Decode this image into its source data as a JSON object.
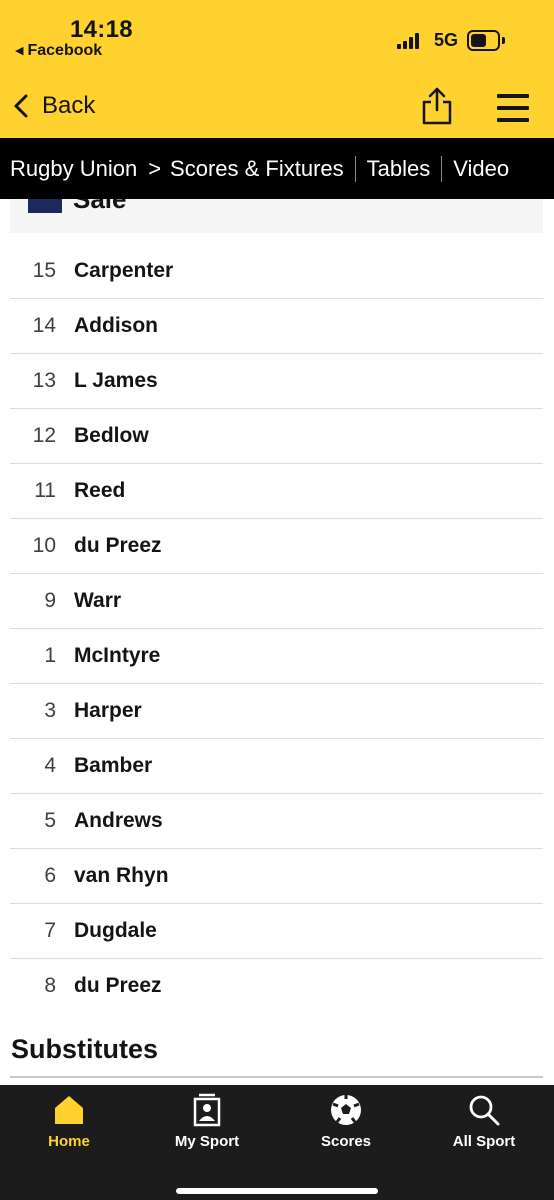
{
  "status": {
    "time": "14:18",
    "source_app": "Facebook",
    "network": "5G"
  },
  "header": {
    "back_label": "Back"
  },
  "nav": {
    "breadcrumb": "Rugby Union",
    "items": [
      "Scores & Fixtures",
      "Tables",
      "Video"
    ]
  },
  "team": {
    "name": "Sale"
  },
  "players": [
    {
      "number": "15",
      "name": "Carpenter"
    },
    {
      "number": "14",
      "name": "Addison"
    },
    {
      "number": "13",
      "name": "L James"
    },
    {
      "number": "12",
      "name": "Bedlow"
    },
    {
      "number": "11",
      "name": "Reed"
    },
    {
      "number": "10",
      "name": "du Preez"
    },
    {
      "number": "9",
      "name": "Warr"
    },
    {
      "number": "1",
      "name": "McIntyre"
    },
    {
      "number": "3",
      "name": "Harper"
    },
    {
      "number": "4",
      "name": "Bamber"
    },
    {
      "number": "5",
      "name": "Andrews"
    },
    {
      "number": "6",
      "name": "van Rhyn"
    },
    {
      "number": "7",
      "name": "Dugdale"
    },
    {
      "number": "8",
      "name": "du Preez"
    }
  ],
  "section": {
    "substitutes": "Substitutes"
  },
  "tabs": [
    {
      "label": "Home",
      "icon": "home-icon",
      "active": true
    },
    {
      "label": "My Sport",
      "icon": "my-sport-icon",
      "active": false
    },
    {
      "label": "Scores",
      "icon": "football-icon",
      "active": false
    },
    {
      "label": "All Sport",
      "icon": "search-icon",
      "active": false
    }
  ],
  "colors": {
    "brand_yellow": "#ffd230",
    "nav_black": "#000000",
    "tabbar": "#1c1c1c"
  }
}
